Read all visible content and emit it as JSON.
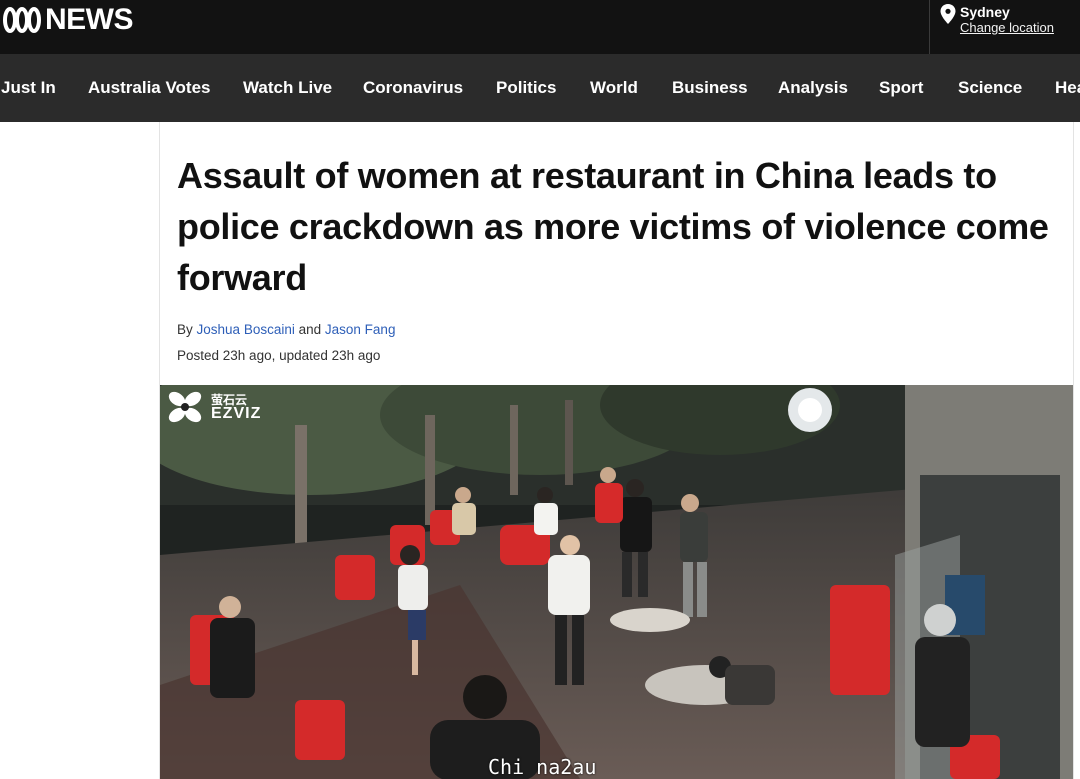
{
  "header": {
    "logo_text": "NEWS",
    "location": {
      "city": "Sydney",
      "change_label": "Change location"
    }
  },
  "nav": {
    "items": [
      {
        "label": "Just In"
      },
      {
        "label": "Australia Votes"
      },
      {
        "label": "Watch Live"
      },
      {
        "label": "Coronavirus"
      },
      {
        "label": "Politics"
      },
      {
        "label": "World"
      },
      {
        "label": "Business"
      },
      {
        "label": "Analysis"
      },
      {
        "label": "Sport"
      },
      {
        "label": "Science"
      },
      {
        "label": "Hea"
      }
    ]
  },
  "article": {
    "headline": "Assault of women at restaurant in China leads to police crackdown as more victims of violence come forward",
    "byline_prefix": "By",
    "author_1": "Joshua Boscaini",
    "byline_and": "and",
    "author_2": "Jason Fang",
    "posted": "Posted 23h ago, updated 23h ago"
  },
  "image": {
    "watermark_cn": "萤石云",
    "watermark_en": "EZVIZ",
    "overlay_text": "Chi na2au"
  },
  "colors": {
    "topbar": "#121212",
    "nav": "#2b2b2b",
    "link": "#2e5fb8"
  }
}
